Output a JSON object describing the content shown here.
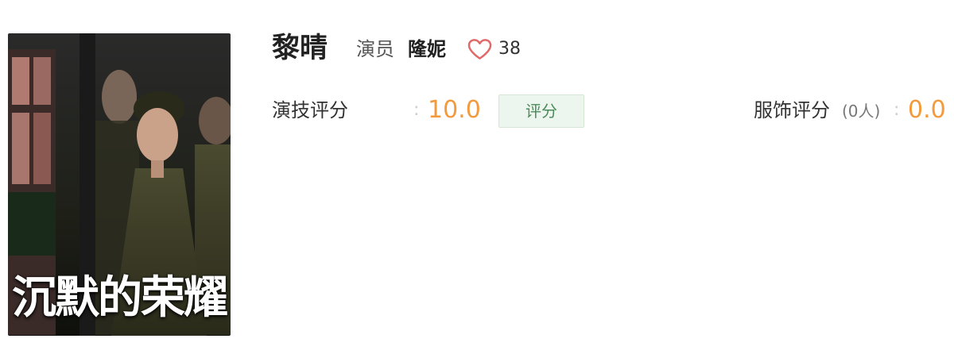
{
  "poster": {
    "title": "沉默的荣耀"
  },
  "actor": {
    "name": "黎晴",
    "role_label": "演员",
    "role_name": "隆妮",
    "likes": "38"
  },
  "ratings": {
    "acting": {
      "label": "演技评分",
      "separator": ":",
      "score": "10.0"
    },
    "rate_button": "评分",
    "costume": {
      "label": "服饰评分",
      "count": "(0人)",
      "separator": ":",
      "score": "0.0"
    }
  },
  "colors": {
    "score": "#f39a3c",
    "button_bg": "#edf6ee",
    "button_text": "#4a8a5a",
    "heart": "#e06a6a"
  },
  "icons": {
    "like": "heart-icon"
  }
}
